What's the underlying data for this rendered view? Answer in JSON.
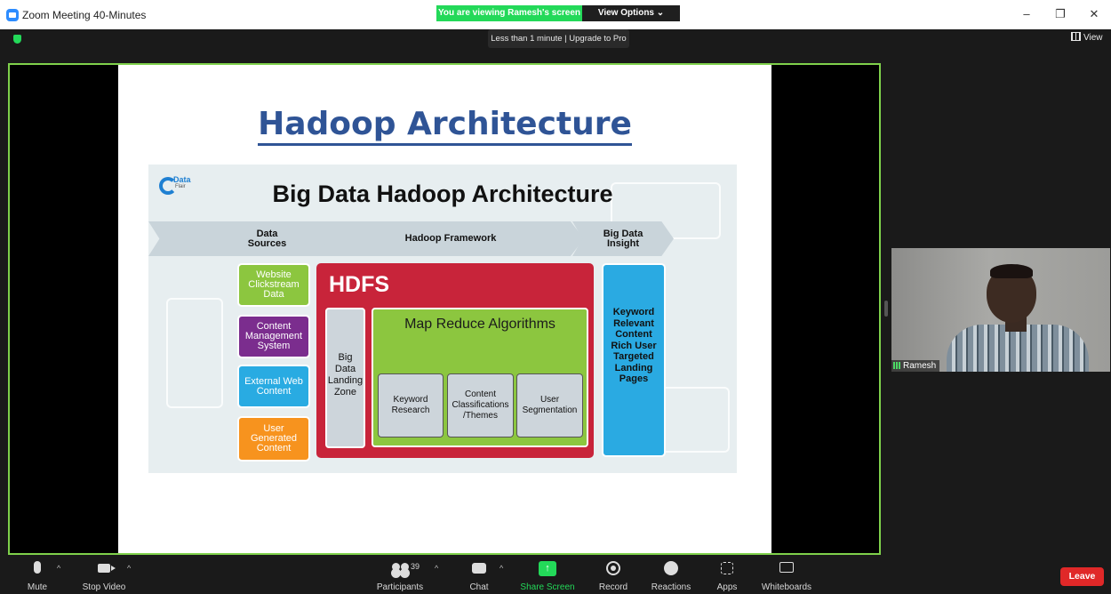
{
  "window": {
    "title": "Zoom Meeting 40-Minutes",
    "viewing_banner": "You are viewing Ramesh's screen",
    "view_options": "View Options ⌄",
    "controls": {
      "minimize": "–",
      "restore": "❐",
      "close": "✕"
    }
  },
  "meeting": {
    "timer_text": "Less than 1 minute | Upgrade to Pro",
    "view_label": "View"
  },
  "slide": {
    "title": "Hadoop Architecture",
    "diagram": {
      "brand": "Data",
      "brand_sub": "Flair",
      "title": "Big Data Hadoop Architecture",
      "stages": [
        "Data Sources",
        "Hadoop Framework",
        "Big Data Insight"
      ],
      "sources": [
        {
          "label": "Website Clickstream Data",
          "color": "#8cc63f"
        },
        {
          "label": "Content Management System",
          "color": "#7b2d8e"
        },
        {
          "label": "External Web Content",
          "color": "#29abe2"
        },
        {
          "label": "User Generated Content",
          "color": "#f7931e"
        }
      ],
      "hdfs_label": "HDFS",
      "landing_zone": "Big Data Landing Zone",
      "map_reduce_label": "Map Reduce Algorithms",
      "algorithms": [
        "Keyword Research",
        "Content Classifications /Themes",
        "User Segmentation"
      ],
      "insight": "Keyword Relevant Content Rich User Targeted Landing Pages"
    }
  },
  "participant": {
    "name": "Ramesh"
  },
  "toolbar": {
    "mute": "Mute",
    "stop_video": "Stop Video",
    "participants": "Participants",
    "participants_count": "39",
    "chat": "Chat",
    "share_screen": "Share Screen",
    "record": "Record",
    "reactions": "Reactions",
    "apps": "Apps",
    "whiteboards": "Whiteboards",
    "leave": "Leave",
    "accent": "#23d959",
    "leave_color": "#e02828"
  }
}
